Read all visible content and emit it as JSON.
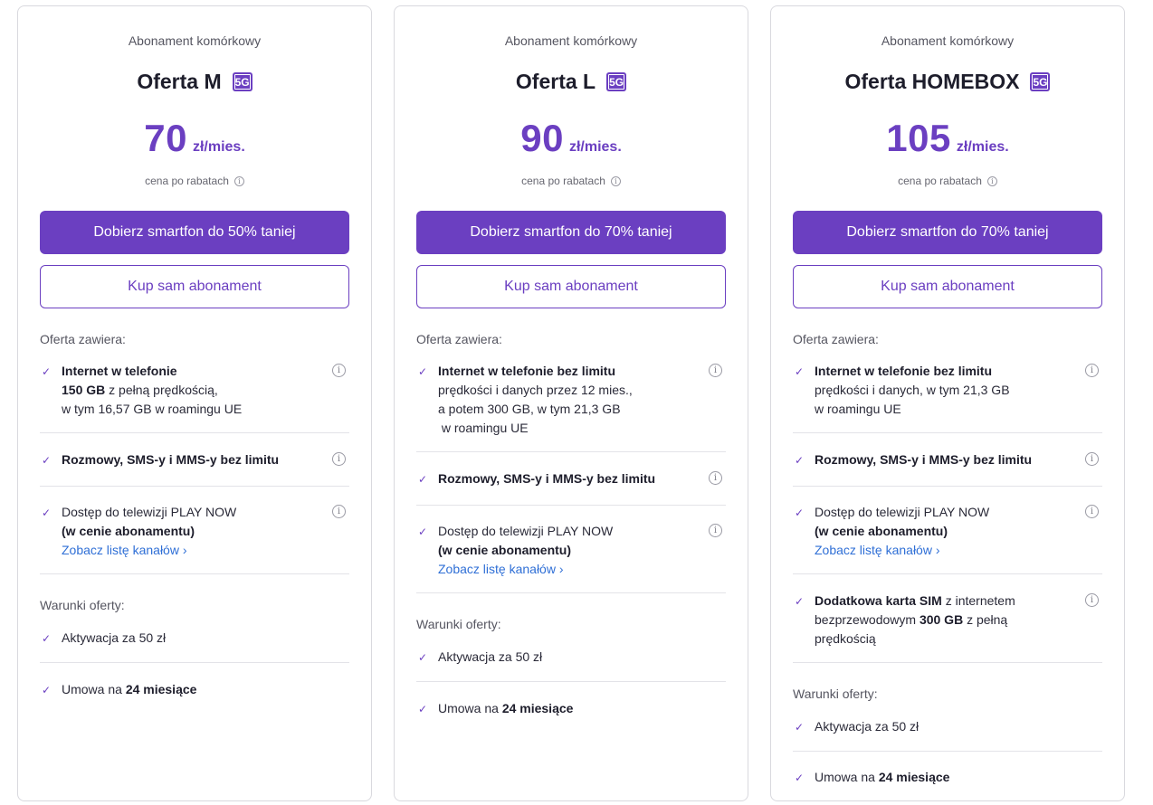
{
  "cards": [
    {
      "subtitle": "Abonament komórkowy",
      "title": "Oferta M",
      "badge": "5G",
      "price": "70",
      "price_unit": "zł/mies.",
      "price_note": "cena po rabatach",
      "primary_button": "Dobierz smartfon do 50% taniej",
      "secondary_button": "Kup sam abonament",
      "includes_label": "Oferta zawiera:",
      "features": {
        "internet": {
          "bold": "Internet w telefonie",
          "line2_bold": "150 GB",
          "line2_rest": " z pełną prędkością,",
          "line3": "w tym 16,57 GB w roamingu UE"
        },
        "calls": "Rozmowy, SMS-y i MMS-y bez limitu",
        "tv": {
          "line1": "Dostęp do telewizji PLAY NOW",
          "line2": "(w cenie abonamentu)",
          "link": "Zobacz listę kanałów"
        }
      },
      "terms_label": "Warunki oferty:",
      "activation": "Aktywacja za 50 zł",
      "contract_prefix": "Umowa na ",
      "contract_bold": "24 miesiące"
    },
    {
      "subtitle": "Abonament komórkowy",
      "title": "Oferta L",
      "badge": "5G",
      "price": "90",
      "price_unit": "zł/mies.",
      "price_note": "cena po rabatach",
      "primary_button": "Dobierz smartfon do 70% taniej",
      "secondary_button": "Kup sam abonament",
      "includes_label": "Oferta zawiera:",
      "features": {
        "internet": {
          "bold": "Internet w telefonie bez limitu",
          "line2": "prędkości i danych przez 12 mies.,",
          "line3": "a potem 300 GB, w tym 21,3 GB",
          "line4": " w roamingu UE"
        },
        "calls": "Rozmowy, SMS-y i MMS-y bez limitu",
        "tv": {
          "line1": "Dostęp do telewizji PLAY NOW",
          "line2": "(w cenie abonamentu)",
          "link": "Zobacz listę kanałów"
        }
      },
      "terms_label": "Warunki oferty:",
      "activation": "Aktywacja za 50 zł",
      "contract_prefix": "Umowa na ",
      "contract_bold": "24 miesiące"
    },
    {
      "subtitle": "Abonament komórkowy",
      "title": "Oferta HOMEBOX",
      "badge": "5G",
      "price": "105",
      "price_unit": "zł/mies.",
      "price_note": "cena po rabatach",
      "primary_button": "Dobierz smartfon do 70% taniej",
      "secondary_button": "Kup sam abonament",
      "includes_label": "Oferta zawiera:",
      "features": {
        "internet": {
          "bold": "Internet w telefonie bez limitu",
          "line2": "prędkości i danych, w tym 21,3 GB",
          "line3": "w roamingu UE"
        },
        "calls": "Rozmowy, SMS-y i MMS-y bez limitu",
        "tv": {
          "line1": "Dostęp do telewizji PLAY NOW",
          "line2": "(w cenie abonamentu)",
          "link": "Zobacz listę kanałów"
        },
        "sim": {
          "bold": "Dodatkowa karta SIM",
          "rest1": " z internetem",
          "line2_pre": "bezprzewodowym ",
          "line2_bold": "300 GB",
          "line2_rest": " z pełną",
          "line3": "prędkością"
        }
      },
      "terms_label": "Warunki oferty:",
      "activation": "Aktywacja za 50 zł",
      "contract_prefix": "Umowa na ",
      "contract_bold": "24 miesiące"
    }
  ],
  "icons": {
    "check": "check-icon",
    "info": "info-icon",
    "chevron": "chevron-right-icon"
  },
  "colors": {
    "accent": "#6b3fc1",
    "link": "#2f6fd6",
    "divider": "#e3e3e8"
  }
}
